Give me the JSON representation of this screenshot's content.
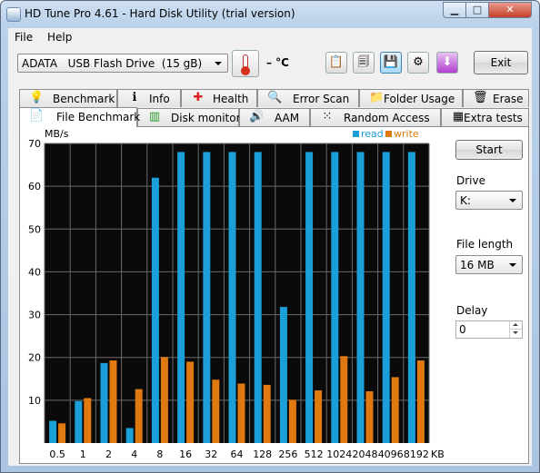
{
  "window": {
    "title": "HD Tune Pro 4.61 - Hard Disk Utility (trial version)"
  },
  "menu": {
    "file": "File",
    "help": "Help"
  },
  "toolbar": {
    "drive": "ADATA   USB Flash Drive  (15 gB)",
    "temperature": "– °C",
    "icons": [
      "copy-text-icon",
      "copy-screenshot-icon",
      "save-icon",
      "options-icon",
      "download-icon"
    ],
    "exit_label": "Exit"
  },
  "tabs_row1": [
    {
      "label": "Benchmark",
      "icon": "benchmark-icon"
    },
    {
      "label": "Info",
      "icon": "info-icon"
    },
    {
      "label": "Health",
      "icon": "health-icon"
    },
    {
      "label": "Error Scan",
      "icon": "error-scan-icon"
    },
    {
      "label": "Folder Usage",
      "icon": "folder-icon"
    },
    {
      "label": "Erase",
      "icon": "trash-icon"
    }
  ],
  "tabs_row2": [
    {
      "label": "File Benchmark",
      "icon": "file-benchmark-icon"
    },
    {
      "label": "Disk monitor",
      "icon": "disk-monitor-icon"
    },
    {
      "label": "AAM",
      "icon": "speaker-icon"
    },
    {
      "label": "Random Access",
      "icon": "random-access-icon"
    },
    {
      "label": "Extra tests",
      "icon": "extra-tests-icon"
    }
  ],
  "side": {
    "start_label": "Start",
    "drive_label": "Drive",
    "drive_value": "K:",
    "file_length_label": "File length",
    "file_length_value": "16 MB",
    "delay_label": "Delay",
    "delay_value": "0"
  },
  "colors": {
    "read": "#1a9fd8",
    "write": "#e07a10",
    "plot_bg": "#0a0a0a",
    "grid": "#6a6a6a"
  },
  "chart_data": {
    "type": "bar",
    "ylabel": "MB/s",
    "xunit": "KB",
    "ylim": [
      0,
      70
    ],
    "yticks": [
      10,
      20,
      30,
      40,
      50,
      60,
      70
    ],
    "grid": true,
    "legend": "top-right",
    "categories": [
      "0.5",
      "1",
      "2",
      "4",
      "8",
      "16",
      "32",
      "64",
      "128",
      "256",
      "512",
      "1024",
      "2048",
      "4096",
      "8192"
    ],
    "series": [
      {
        "name": "read",
        "values": [
          5.2,
          9.8,
          18.7,
          3.5,
          62,
          68,
          68,
          68,
          68,
          31.8,
          68,
          68,
          68,
          68,
          68
        ]
      },
      {
        "name": "write",
        "values": [
          4.6,
          10.5,
          19.3,
          12.6,
          20.1,
          19,
          14.8,
          13.9,
          13.6,
          10.1,
          12.3,
          20.3,
          12.1,
          15.4,
          19.3
        ]
      }
    ]
  }
}
